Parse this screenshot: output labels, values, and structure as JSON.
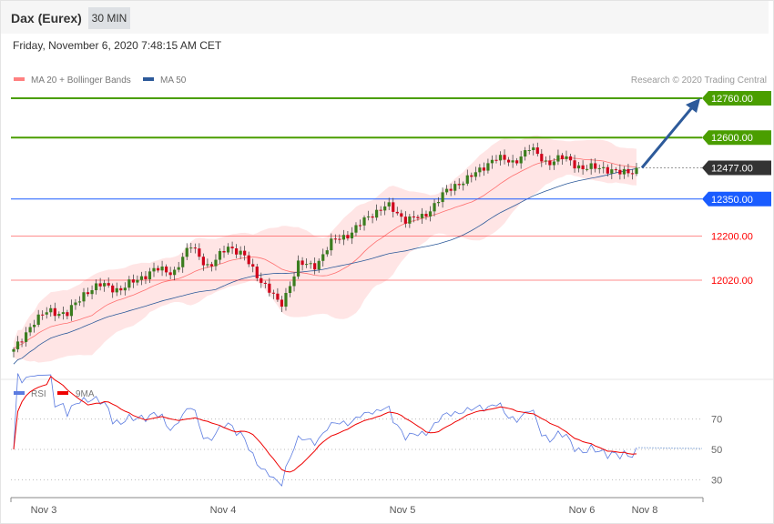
{
  "header": {
    "title": "Dax (Eurex)",
    "timeframe": "30 MIN",
    "datetime": "Friday, November 6, 2020 7:48:15 AM CET"
  },
  "legend": {
    "bb": "MA 20 + Bollinger Bands",
    "ma50": "MA 50",
    "rsi": "RSI",
    "ma9": "9MA",
    "credit": "Research © 2020 Trading Central"
  },
  "colors": {
    "up": "#3a7d1e",
    "down": "#d0021b",
    "bb": "#ff8080",
    "ma50": "#2d5a9a",
    "resist": "#4a9e00",
    "current": "#333333",
    "pivot": "#1a5cff",
    "support": "#ff0000"
  },
  "levels": [
    {
      "label": "12760.00",
      "value": 12760,
      "kind": "resist"
    },
    {
      "label": "12600.00",
      "value": 12600,
      "kind": "resist"
    },
    {
      "label": "12477.00",
      "value": 12477,
      "kind": "current"
    },
    {
      "label": "12350.00",
      "value": 12350,
      "kind": "pivot"
    },
    {
      "label": "12200.00",
      "value": 12200,
      "kind": "support"
    },
    {
      "label": "12020.00",
      "value": 12020,
      "kind": "support"
    }
  ],
  "chart_data": {
    "type": "candlestick",
    "instrument": "Dax (Eurex)",
    "interval": "30 MIN",
    "price_key_closes": [
      11731,
      11842,
      11898,
      11880,
      11972,
      12002,
      11980,
      12027,
      12064,
      12053,
      12164,
      12064,
      12164,
      12112,
      12009,
      11916,
      12083,
      12083,
      12186,
      12212,
      12286,
      12323,
      12268,
      12275,
      12360,
      12416,
      12453,
      12520,
      12497,
      12556,
      12497,
      12520,
      12471,
      12482,
      12453,
      12471
    ],
    "ylim": [
      11650,
      12800
    ],
    "x_ticks": [
      "Nov 3",
      "Nov 4",
      "Nov 5",
      "Nov 6",
      "Nov 8"
    ],
    "rsi_ticks": [
      70,
      50,
      30
    ],
    "forecast_target": 12760
  }
}
